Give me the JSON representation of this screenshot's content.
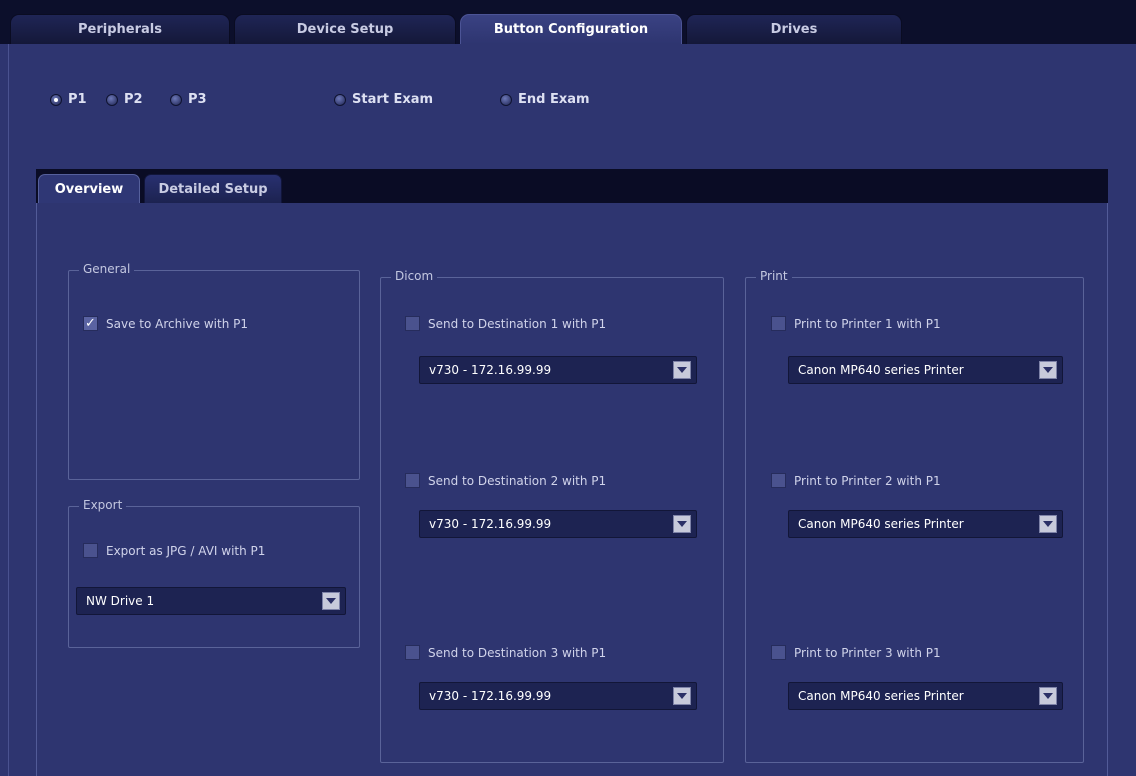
{
  "top_tabs": [
    "Peripherals",
    "Device Setup",
    "Button Configuration",
    "Drives"
  ],
  "radios": {
    "p1": "P1",
    "p2": "P2",
    "p3": "P3",
    "start_exam": "Start Exam",
    "end_exam": "End Exam"
  },
  "sub_tabs": [
    "Overview",
    "Detailed Setup"
  ],
  "general": {
    "title": "General",
    "save_archive": "Save to Archive with P1"
  },
  "export": {
    "title": "Export",
    "export_jpg": "Export as JPG / AVI with P1",
    "drive": "NW Drive 1"
  },
  "dicom": {
    "title": "Dicom",
    "items": [
      {
        "label": "Send to Destination 1 with P1",
        "value": "v730 - 172.16.99.99"
      },
      {
        "label": "Send to Destination 2 with P1",
        "value": "v730 - 172.16.99.99"
      },
      {
        "label": "Send to Destination 3 with P1",
        "value": "v730 - 172.16.99.99"
      }
    ]
  },
  "print": {
    "title": "Print",
    "items": [
      {
        "label": "Print to Printer 1 with P1",
        "value": "Canon MP640 series Printer"
      },
      {
        "label": "Print to Printer 2 with P1",
        "value": "Canon MP640 series Printer"
      },
      {
        "label": "Print to Printer 3 with P1",
        "value": "Canon MP640 series Printer"
      }
    ]
  },
  "checkmark": "✓"
}
